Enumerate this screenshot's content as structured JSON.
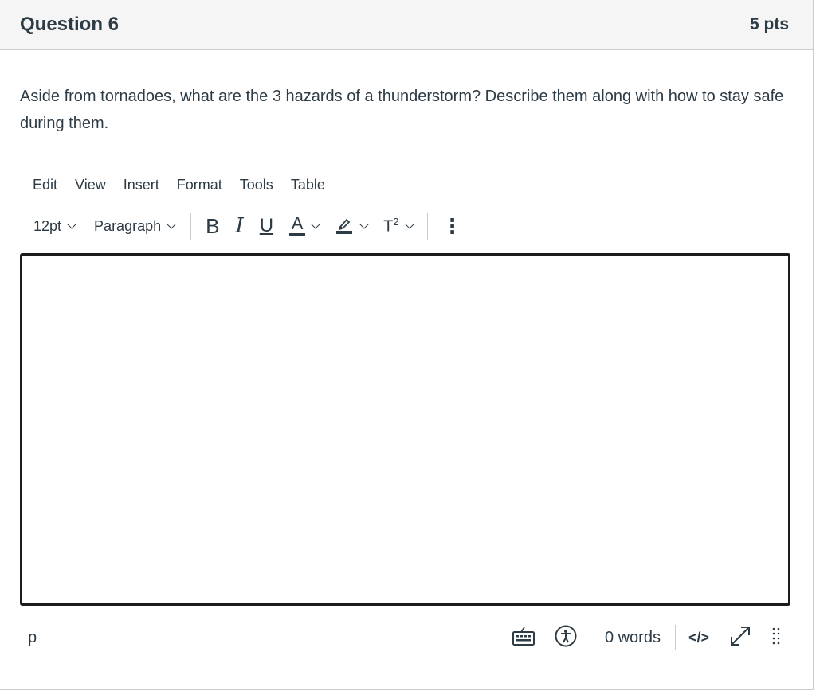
{
  "question": {
    "title": "Question 6",
    "points": "5 pts",
    "text": "Aside from tornadoes, what are the 3 hazards of a thunderstorm? Describe them along with how to stay safe during them."
  },
  "menubar": {
    "items": [
      "Edit",
      "View",
      "Insert",
      "Format",
      "Tools",
      "Table"
    ]
  },
  "toolbar": {
    "font_size": "12pt",
    "block_format": "Paragraph",
    "bold_label": "B",
    "italic_label": "I",
    "underline_label": "U",
    "font_color_label": "A",
    "superscript_label": "T",
    "superscript_mark": "2",
    "more_label": "⋮",
    "icons": {
      "highlight": "highlighter-icon",
      "more": "more-vertical-icon"
    }
  },
  "editor": {
    "content": ""
  },
  "statusbar": {
    "path": "p",
    "word_count": "0 words",
    "html_editor_label": "</>",
    "icons": {
      "keyboard": "keyboard-icon",
      "accessibility": "accessibility-icon",
      "fullscreen": "fullscreen-icon",
      "resize": "resize-handle-icon"
    }
  }
}
